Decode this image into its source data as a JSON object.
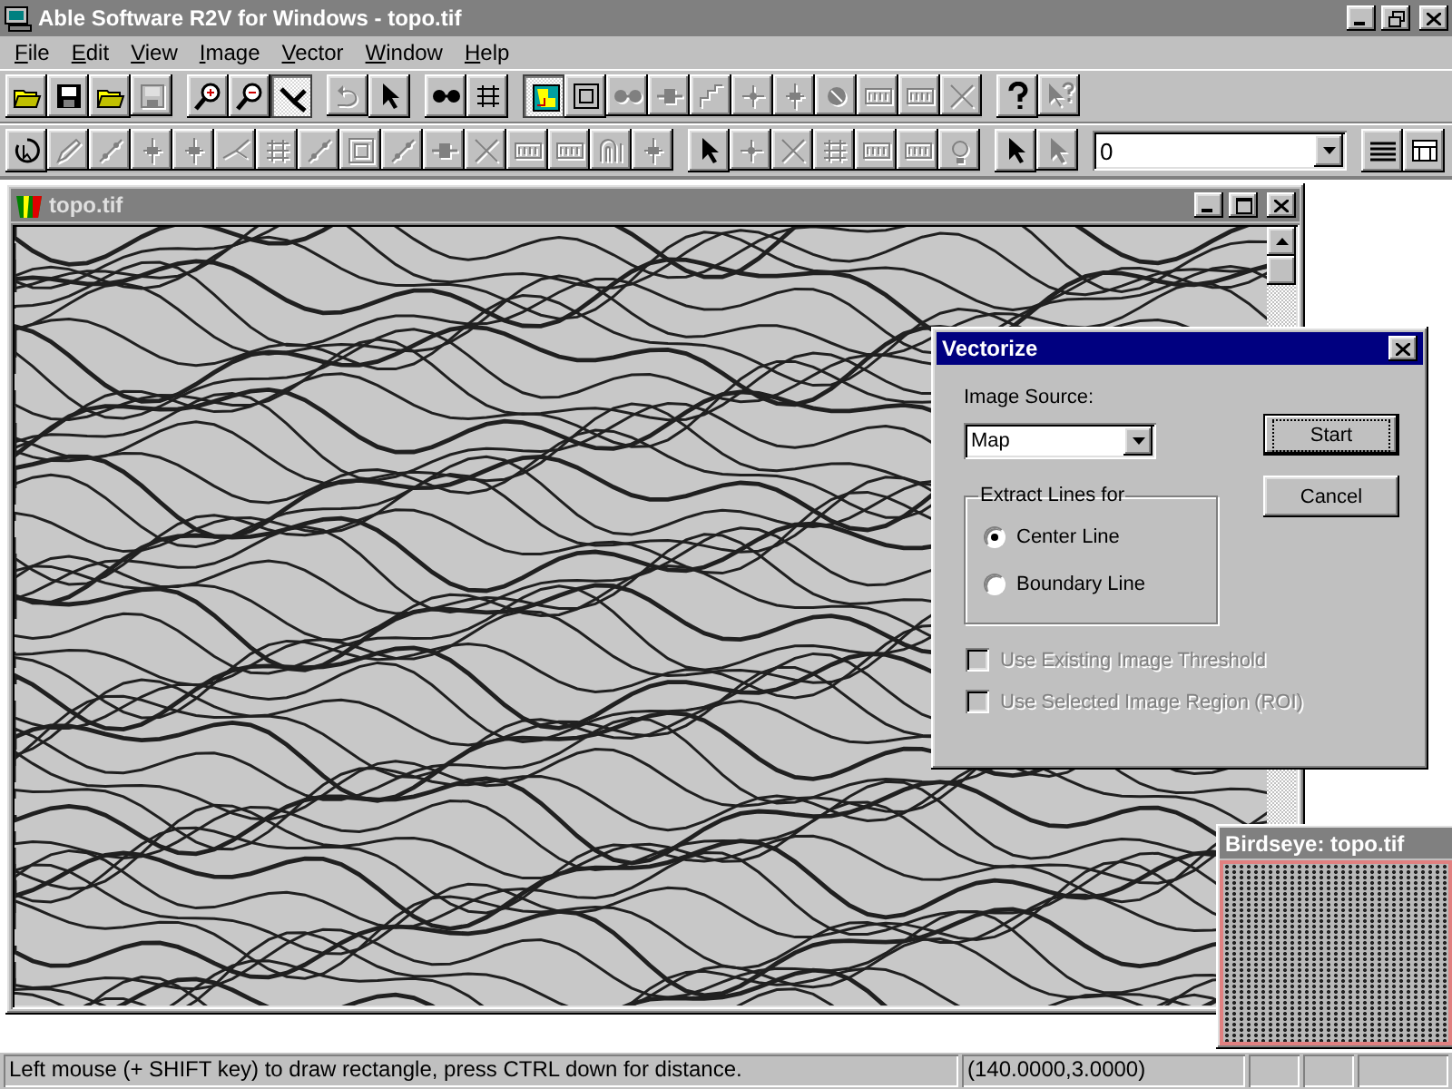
{
  "window": {
    "title": "Able Software R2V for Windows - topo.tif"
  },
  "menu": [
    {
      "label": "File"
    },
    {
      "label": "Edit"
    },
    {
      "label": "View"
    },
    {
      "label": "Image"
    },
    {
      "label": "Vector"
    },
    {
      "label": "Window"
    },
    {
      "label": "Help"
    }
  ],
  "toolbar_1": {
    "groups": [
      [
        {
          "pressed": false,
          "disabled": false
        },
        {
          "pressed": false,
          "disabled": false
        },
        {
          "pressed": false,
          "disabled": false
        },
        {
          "pressed": false,
          "disabled": true
        }
      ],
      [
        {
          "pressed": false,
          "disabled": false
        },
        {
          "pressed": false,
          "disabled": false
        },
        {
          "pressed": true,
          "disabled": false
        }
      ],
      [
        {
          "pressed": false,
          "disabled": true
        },
        {
          "pressed": false,
          "disabled": false
        }
      ],
      [
        {
          "pressed": false,
          "disabled": false
        },
        {
          "pressed": false,
          "disabled": false
        }
      ],
      [
        {
          "pressed": true,
          "disabled": false
        },
        {
          "pressed": false,
          "disabled": false
        },
        {
          "pressed": false,
          "disabled": true
        },
        {
          "pressed": false,
          "disabled": true
        },
        {
          "pressed": false,
          "disabled": true
        },
        {
          "pressed": false,
          "disabled": true
        },
        {
          "pressed": false,
          "disabled": true
        },
        {
          "pressed": false,
          "disabled": true
        },
        {
          "pressed": false,
          "disabled": true
        },
        {
          "pressed": false,
          "disabled": true
        },
        {
          "pressed": false,
          "disabled": true
        }
      ],
      [
        {
          "pressed": false,
          "disabled": false
        },
        {
          "pressed": false,
          "disabled": true
        }
      ]
    ]
  },
  "toolbar_2": {
    "groups_before": [
      [
        {
          "pressed": false,
          "disabled": false
        },
        {
          "pressed": false,
          "disabled": true
        },
        {
          "pressed": false,
          "disabled": true
        },
        {
          "pressed": false,
          "disabled": true
        },
        {
          "pressed": false,
          "disabled": true
        },
        {
          "pressed": false,
          "disabled": true
        },
        {
          "pressed": false,
          "disabled": true
        },
        {
          "pressed": false,
          "disabled": true
        },
        {
          "pressed": false,
          "disabled": true
        },
        {
          "pressed": false,
          "disabled": true
        },
        {
          "pressed": false,
          "disabled": true
        },
        {
          "pressed": false,
          "disabled": true
        },
        {
          "pressed": false,
          "disabled": true
        },
        {
          "pressed": false,
          "disabled": true
        },
        {
          "pressed": false,
          "disabled": true
        },
        {
          "pressed": false,
          "disabled": true
        }
      ],
      [
        {
          "pressed": false,
          "disabled": false
        },
        {
          "pressed": false,
          "disabled": true
        },
        {
          "pressed": false,
          "disabled": true
        },
        {
          "pressed": false,
          "disabled": true
        },
        {
          "pressed": false,
          "disabled": true
        },
        {
          "pressed": false,
          "disabled": true
        },
        {
          "pressed": false,
          "disabled": true
        }
      ],
      [
        {
          "pressed": false,
          "disabled": false
        },
        {
          "pressed": false,
          "disabled": true
        }
      ]
    ],
    "layer_combo": {
      "value": "0"
    },
    "groups_after": [
      [
        {
          "pressed": false,
          "disabled": false
        },
        {
          "pressed": false,
          "disabled": false
        }
      ]
    ]
  },
  "document": {
    "title": "topo.tif"
  },
  "dialog": {
    "title": "Vectorize",
    "image_source_label": "Image Source:",
    "image_source": "Map",
    "buttons": [
      {
        "label": "Start",
        "default": true
      },
      {
        "label": "Cancel",
        "default": false
      }
    ],
    "group_label": "Extract Lines for",
    "radios": [
      {
        "label": "Center Line",
        "selected": true
      },
      {
        "label": "Boundary Line",
        "selected": false
      }
    ],
    "checkboxes": [
      {
        "label": "Use Existing Image Threshold",
        "checked": false,
        "disabled": true
      },
      {
        "label": "Use Selected Image Region (ROI)",
        "checked": false,
        "disabled": true
      }
    ]
  },
  "birdseye": {
    "title": "Birdseye: topo.tif"
  },
  "status_bar": {
    "message": "Left mouse (+ SHIFT key) to draw rectangle, press CTRL down for distance.",
    "coordinates": "(140.0000,3.0000)"
  }
}
